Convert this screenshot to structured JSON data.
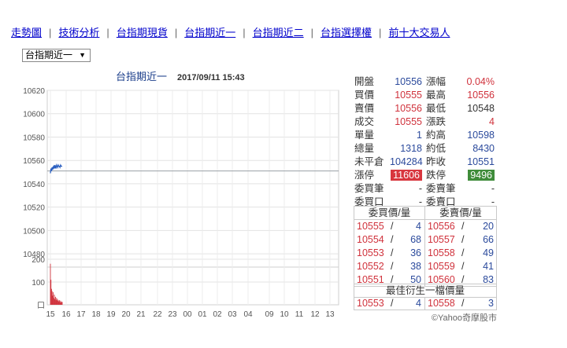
{
  "nav": {
    "items": [
      "走勢圖",
      "技術分析",
      "台指期現貨",
      "台指期近一",
      "台指期近二",
      "台指選擇權",
      "前十大交易人"
    ],
    "separator": "|"
  },
  "contract_select": {
    "value": "台指期近一",
    "arrow": "▼"
  },
  "chart": {
    "title_name": "台指期近一",
    "title_time": "2017/09/11 15:43",
    "reference_price": 10551,
    "price_ticks": [
      "10620",
      "10600",
      "10580",
      "10560",
      "10540",
      "10520",
      "10500",
      "10480"
    ],
    "volume_ticks": [
      "200",
      "100",
      "口"
    ],
    "time_ticks": [
      "15",
      "16",
      "17",
      "18",
      "19",
      "20",
      "21",
      "22",
      "23",
      "00",
      "01",
      "02",
      "03",
      "04",
      "09",
      "10",
      "11",
      "12",
      "13"
    ]
  },
  "chart_data": {
    "type": "line",
    "title": "台指期近一 2017/09/11 15:43",
    "xlabel": "",
    "ylabel": "",
    "ylim": [
      10470,
      10620
    ],
    "x": [
      "15:00",
      "15:02",
      "15:04",
      "15:06",
      "15:08",
      "15:10",
      "15:12",
      "15:14",
      "15:16",
      "15:18",
      "15:20",
      "15:22",
      "15:24",
      "15:26",
      "15:28",
      "15:30",
      "15:32",
      "15:34",
      "15:36",
      "15:38",
      "15:40",
      "15:43"
    ],
    "series": [
      {
        "values": [
          10549,
          10553,
          10551,
          10554,
          10552,
          10555,
          10553,
          10556,
          10554,
          10555,
          10553,
          10556,
          10555,
          10554,
          10556,
          10555,
          10555,
          10554,
          10556,
          10555,
          10555,
          10555
        ]
      }
    ],
    "volume": [
      180,
      110,
      70,
      60,
      40,
      55,
      30,
      45,
      25,
      35,
      20,
      30,
      25,
      18,
      22,
      15,
      20,
      12,
      18,
      10,
      14,
      12
    ],
    "volume_ylim": [
      0,
      200
    ]
  },
  "quote": {
    "open_label": "開盤",
    "open": "10556",
    "chg_pct_label": "漲幅",
    "chg_pct": "0.04%",
    "bid_label": "買價",
    "bid": "10555",
    "high_label": "最高",
    "high": "10556",
    "ask_label": "賣價",
    "ask": "10556",
    "low_label": "最低",
    "low": "10548",
    "last_label": "成交",
    "last": "10555",
    "chg_label": "漲跌",
    "chg": "4",
    "tick_vol_label": "單量",
    "tick_vol": "1",
    "about_high_label": "約高",
    "about_high": "10598",
    "total_vol_label": "總量",
    "total_vol": "1318",
    "about_low_label": "約低",
    "about_low": "8430",
    "oi_label": "未平倉",
    "oi": "104284",
    "prev_close_label": "昨收",
    "prev_close": "10551",
    "limit_up_label": "漲停",
    "limit_up": "11606",
    "limit_down_label": "跌停",
    "limit_down": "9496",
    "bid_orders_label": "委買筆",
    "bid_orders": "-",
    "ask_orders_label": "委賣筆",
    "ask_orders": "-",
    "bid_lots_label": "委買口",
    "bid_lots": "-",
    "ask_lots_label": "委賣口",
    "ask_lots": "-"
  },
  "book": {
    "bid_header": "委買價/量",
    "ask_header": "委賣價/量",
    "rows": [
      {
        "bid_price": "10555",
        "bid_qty": "4",
        "ask_price": "10556",
        "ask_qty": "20"
      },
      {
        "bid_price": "10554",
        "bid_qty": "68",
        "ask_price": "10557",
        "ask_qty": "66"
      },
      {
        "bid_price": "10553",
        "bid_qty": "36",
        "ask_price": "10558",
        "ask_qty": "49"
      },
      {
        "bid_price": "10552",
        "bid_qty": "38",
        "ask_price": "10559",
        "ask_qty": "41"
      },
      {
        "bid_price": "10551",
        "bid_qty": "50",
        "ask_price": "10560",
        "ask_qty": "83"
      }
    ],
    "slash": "/",
    "best_header": "最佳衍生一檔價量",
    "best": {
      "bid_price": "10553",
      "bid_qty": "4",
      "ask_price": "10558",
      "ask_qty": "3"
    }
  },
  "footer": "©Yahoo奇摩股市",
  "colors": {
    "link": "#0000cc",
    "up": "#d0323c",
    "down": "#3f8c3a",
    "line": "#2b5fc0",
    "volume": "#d0323c"
  }
}
